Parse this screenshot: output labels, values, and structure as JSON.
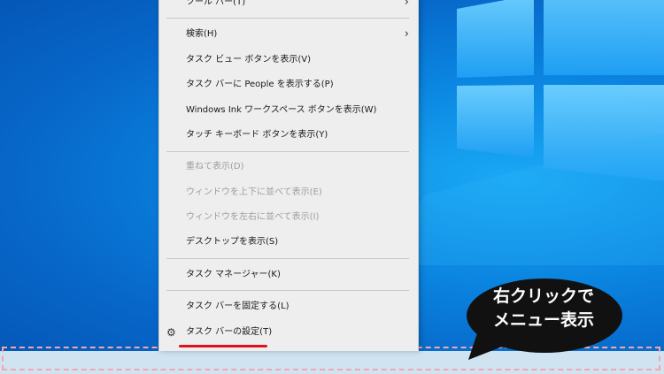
{
  "menu": {
    "items": [
      {
        "label": "ツール バー(T)",
        "disabled": false,
        "submenu": true
      },
      {
        "label": "検索(H)",
        "disabled": false,
        "submenu": true
      },
      {
        "label": "タスク ビュー ボタンを表示(V)",
        "disabled": false
      },
      {
        "label": "タスク バーに People を表示する(P)",
        "disabled": false
      },
      {
        "label": "Windows Ink ワークスペース ボタンを表示(W)",
        "disabled": false
      },
      {
        "label": "タッチ キーボード ボタンを表示(Y)",
        "disabled": false
      },
      {
        "label": "重ねて表示(D)",
        "disabled": true
      },
      {
        "label": "ウィンドウを上下に並べて表示(E)",
        "disabled": true
      },
      {
        "label": "ウィンドウを左右に並べて表示(I)",
        "disabled": true
      },
      {
        "label": "デスクトップを表示(S)",
        "disabled": false
      },
      {
        "label": "タスク マネージャー(K)",
        "disabled": false
      },
      {
        "label": "タスク バーを固定する(L)",
        "disabled": false
      },
      {
        "label": "タスク バーの設定(T)",
        "disabled": false,
        "icon": "gear-icon"
      }
    ],
    "submenu_glyph": "›",
    "gear_glyph": "⚙"
  },
  "callout": {
    "line1": "右クリックで",
    "line2": "メニュー表示"
  },
  "colors": {
    "desktop": "#0a84e0",
    "menu_bg": "#eeeeee",
    "highlight_underline": "#e0101c",
    "dash_border": "#f4a6ad",
    "callout_bg": "#111111"
  }
}
